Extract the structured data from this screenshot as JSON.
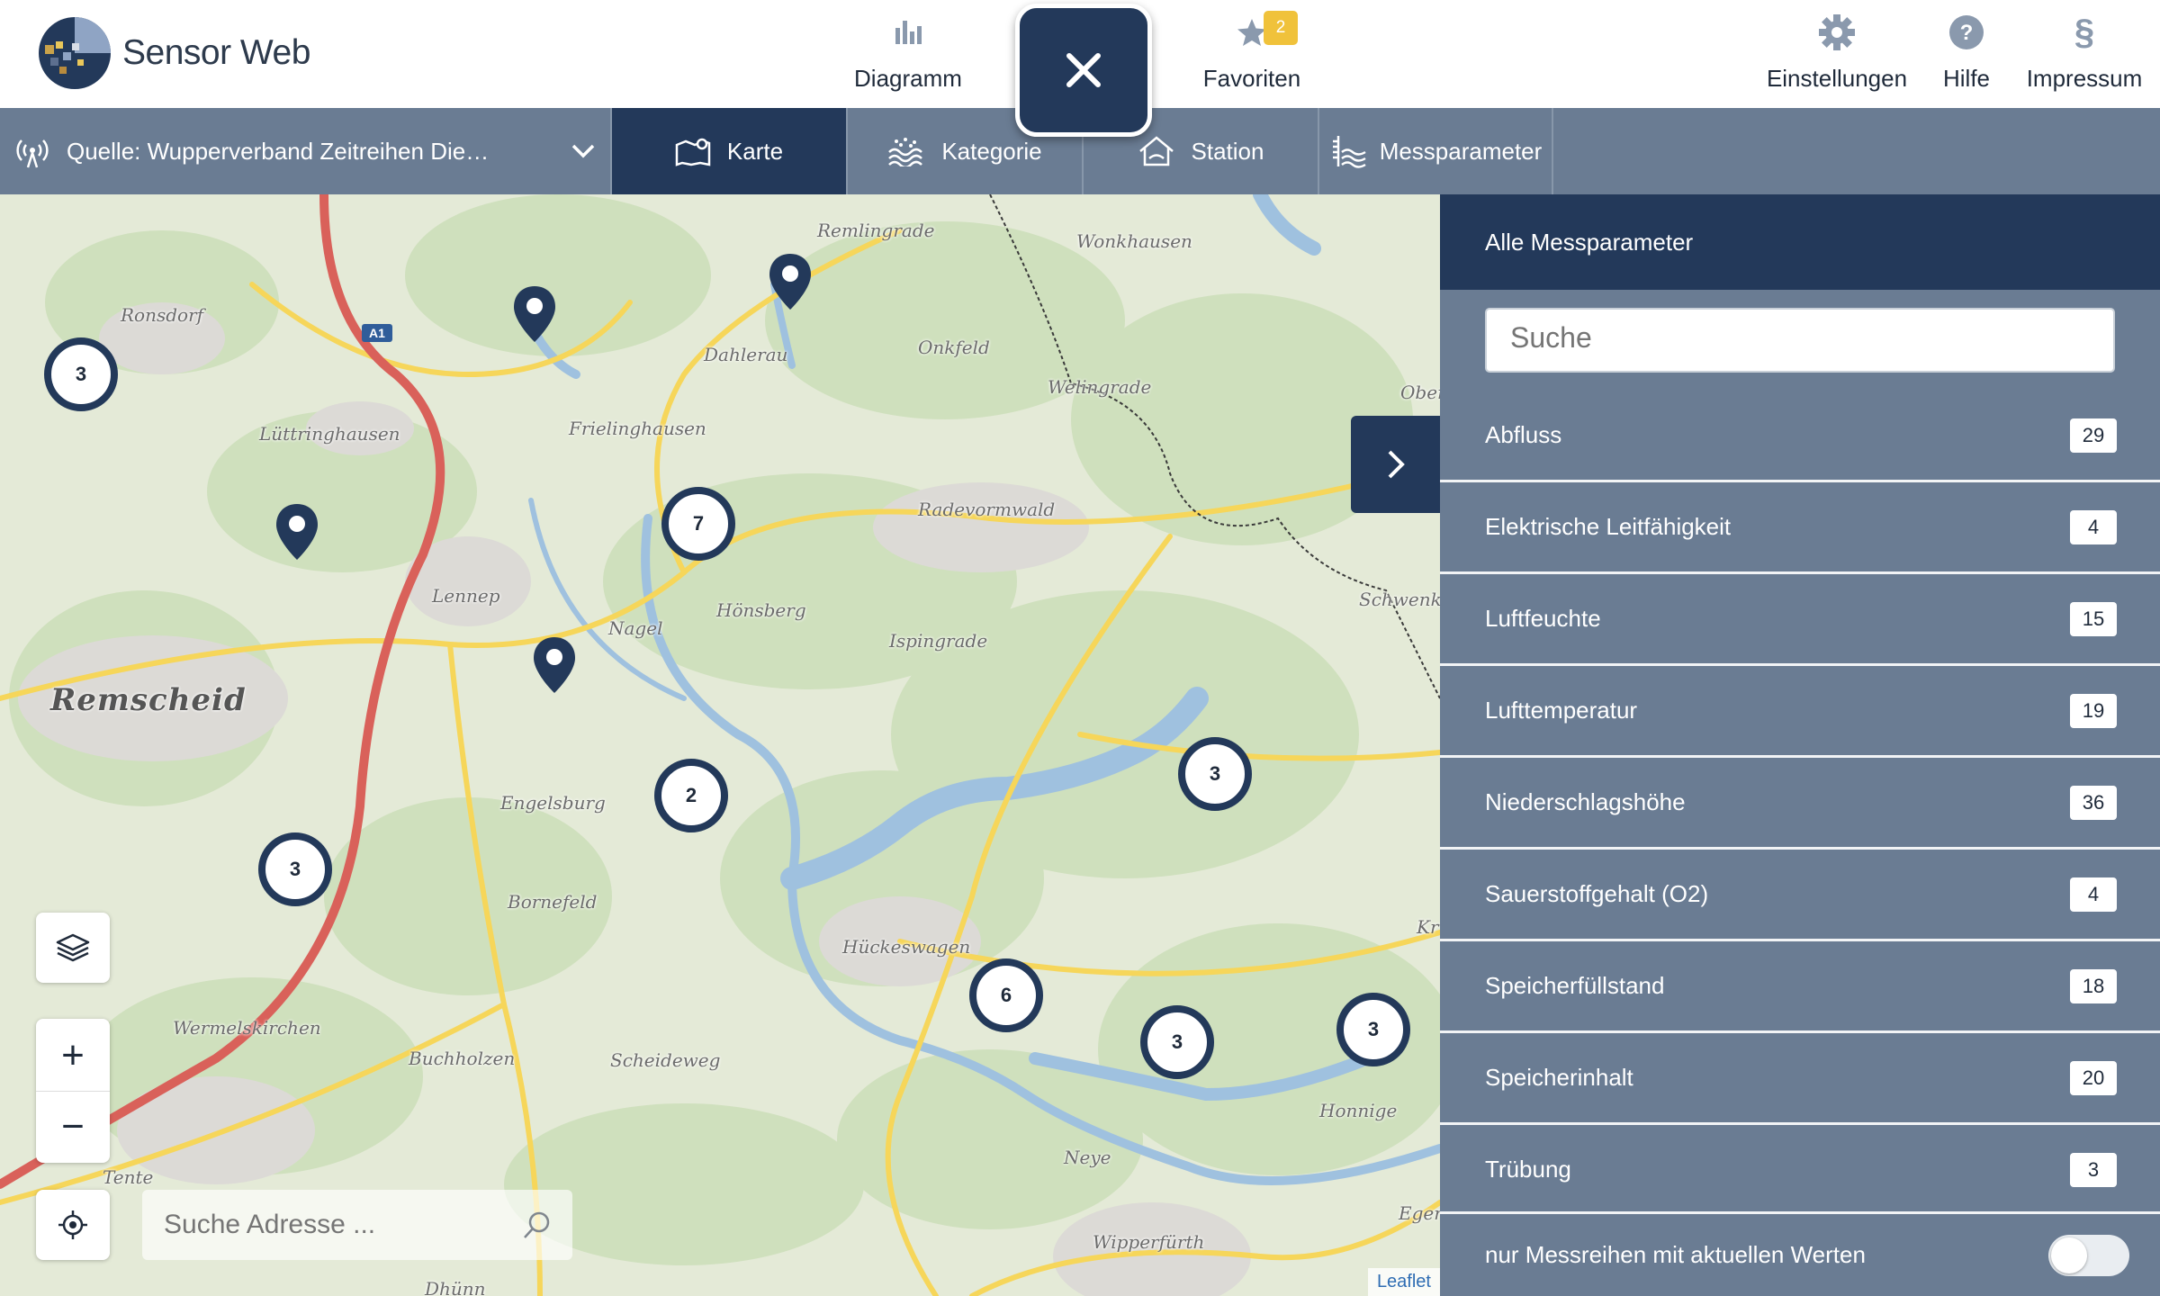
{
  "app": {
    "name": "Sensor Web"
  },
  "colors": {
    "primary": "#23395a",
    "toolbar": "#6a7c93",
    "badge": "#f0c23b",
    "map_water": "#9fc1df",
    "map_road": "#f6d65a",
    "map_motorway": "#d9615a"
  },
  "nav": {
    "diagram": {
      "label": "Diagramm",
      "icon": "bar-chart-icon"
    },
    "close": {
      "icon": "close-icon"
    },
    "favorites": {
      "label": "Favoriten",
      "icon": "star-icon",
      "badge": "2"
    },
    "settings": {
      "label": "Einstellungen",
      "icon": "gear-icon"
    },
    "help": {
      "label": "Hilfe",
      "icon": "question-icon"
    },
    "imprint": {
      "label": "Impressum",
      "icon": "paragraph-icon",
      "glyph": "§"
    }
  },
  "toolbar": {
    "source": {
      "label": "Quelle: Wupperverband Zeitreihen Die…",
      "icon": "antenna-icon",
      "chevron": "chevron-down-icon"
    },
    "tabs": [
      {
        "label": "Karte",
        "icon": "map-icon",
        "active": true
      },
      {
        "label": "Kategorie",
        "icon": "water-icon",
        "active": false
      },
      {
        "label": "Station",
        "icon": "house-icon",
        "active": false
      },
      {
        "label": "Messparameter",
        "icon": "gauge-icon",
        "active": false
      }
    ]
  },
  "map": {
    "places": [
      {
        "name": "Remlingrade"
      },
      {
        "name": "Wonkhausen"
      },
      {
        "name": "Ronsdorf"
      },
      {
        "name": "Dahlerau"
      },
      {
        "name": "Onkfeld"
      },
      {
        "name": "Welingrade"
      },
      {
        "name": "Ober"
      },
      {
        "name": "Lüttringhausen"
      },
      {
        "name": "Frielinghausen"
      },
      {
        "name": "Radevormwald"
      },
      {
        "name": "Lennep"
      },
      {
        "name": "Hönsberg"
      },
      {
        "name": "Nagel"
      },
      {
        "name": "Ispingrade"
      },
      {
        "name": "Schwenke"
      },
      {
        "name": "Remscheid"
      },
      {
        "name": "Engelsburg"
      },
      {
        "name": "Bornefeld"
      },
      {
        "name": "Hückeswagen"
      },
      {
        "name": "Kr"
      },
      {
        "name": "Wermelskirchen"
      },
      {
        "name": "Buchholzen"
      },
      {
        "name": "Scheideweg"
      },
      {
        "name": "Honnige"
      },
      {
        "name": "Neye"
      },
      {
        "name": "Tente"
      },
      {
        "name": "Wipperfürth"
      },
      {
        "name": "Dhünn"
      },
      {
        "name": "Eger"
      }
    ],
    "road_label": "A1",
    "clusters": [
      "3",
      "7",
      "2",
      "3",
      "3",
      "6",
      "3",
      "3"
    ],
    "markers": 4,
    "address_search_placeholder": "Suche Adresse ...",
    "attribution": "Leaflet",
    "controls": {
      "layers": "layers-icon",
      "zoom_in": "+",
      "zoom_out": "−",
      "locate": "crosshair-icon"
    }
  },
  "panel": {
    "title": "Alle Messparameter",
    "search_placeholder": "Suche",
    "items": [
      {
        "label": "Abfluss",
        "count": "29"
      },
      {
        "label": "Elektrische Leitfähigkeit",
        "count": "4"
      },
      {
        "label": "Luftfeuchte",
        "count": "15"
      },
      {
        "label": "Lufttemperatur",
        "count": "19"
      },
      {
        "label": "Niederschlagshöhe",
        "count": "36"
      },
      {
        "label": "Sauerstoffgehalt (O2)",
        "count": "4"
      },
      {
        "label": "Speicherfüllstand",
        "count": "18"
      },
      {
        "label": "Speicherinhalt",
        "count": "20"
      },
      {
        "label": "Trübung",
        "count": "3"
      }
    ],
    "current_only_label": "nur Messreihen mit aktuellen Werten",
    "current_only_enabled": false
  }
}
